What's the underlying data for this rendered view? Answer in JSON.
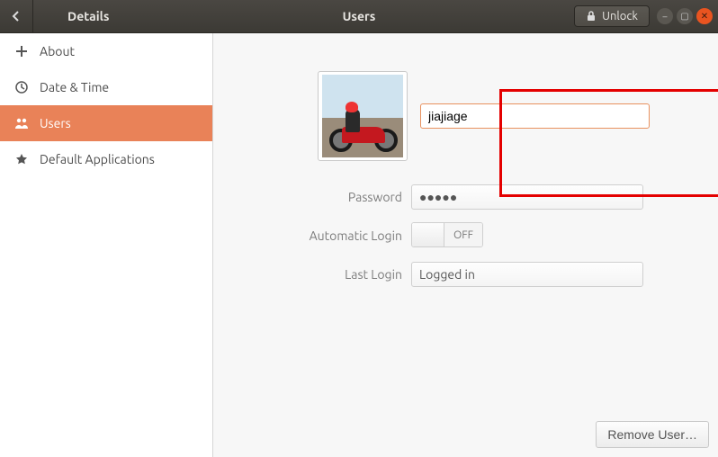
{
  "header": {
    "back_label": "Details",
    "page_title": "Users",
    "unlock_label": "Unlock"
  },
  "sidebar": {
    "items": [
      {
        "label": "About",
        "icon": "plus-icon"
      },
      {
        "label": "Date & Time",
        "icon": "clock-icon"
      },
      {
        "label": "Users",
        "icon": "people-icon"
      },
      {
        "label": "Default Applications",
        "icon": "star-icon"
      }
    ]
  },
  "user": {
    "name_value": "jiajiage",
    "avatar_desc": "person on motorcycle"
  },
  "fields": {
    "password_label": "Password",
    "password_value": "●●●●●",
    "auto_login_label": "Automatic Login",
    "auto_login_state": "OFF",
    "last_login_label": "Last Login",
    "last_login_value": "Logged in"
  },
  "actions": {
    "remove_user_label": "Remove User…"
  }
}
